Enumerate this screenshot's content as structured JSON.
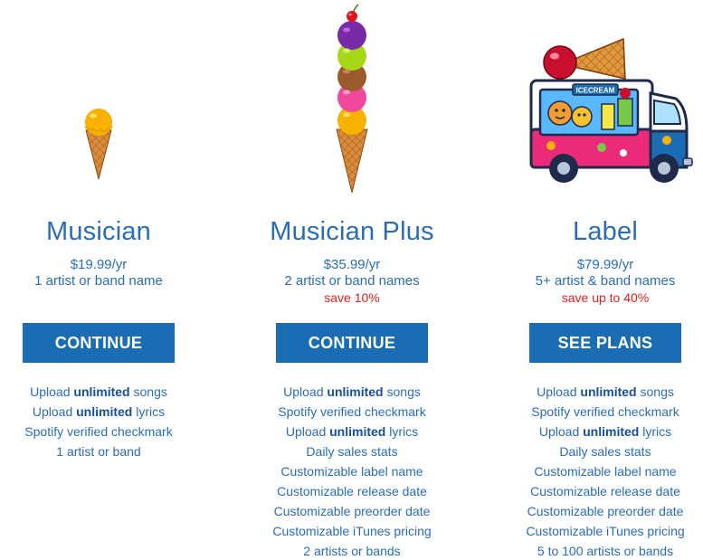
{
  "plans": [
    {
      "illustration": "single-scoop-cone",
      "name": "Musician",
      "price": "$19.99/yr",
      "description": "1 artist or band name",
      "save": "",
      "button": "CONTINUE",
      "features": [
        "Upload unlimited songs",
        "Upload unlimited lyrics",
        "Spotify verified checkmark",
        "1 artist or band"
      ]
    },
    {
      "illustration": "five-scoop-cone",
      "name": "Musician Plus",
      "price": "$35.99/yr",
      "description": "2 artist or band names",
      "save": "save 10%",
      "button": "CONTINUE",
      "features": [
        "Upload unlimited songs",
        "Spotify verified checkmark",
        "Upload unlimited lyrics",
        "Daily sales stats",
        "Customizable label name",
        "Customizable release date",
        "Customizable preorder date",
        "Customizable iTunes pricing",
        "2 artists or bands"
      ]
    },
    {
      "illustration": "ice-cream-truck",
      "name": "Label",
      "price": "$79.99/yr",
      "description": "5+ artist & band names",
      "save": "save up to 40%",
      "button": "SEE PLANS",
      "features": [
        "Upload unlimited songs",
        "Spotify verified checkmark",
        "Upload unlimited lyrics",
        "Daily sales stats",
        "Customizable label name",
        "Customizable release date",
        "Customizable preorder date",
        "Customizable iTunes pricing",
        "5 to 100 artists or bands"
      ]
    }
  ],
  "truck_sign": "ICECREAM",
  "emphasis_word": "unlimited",
  "colors": {
    "title": "#2a6db5",
    "button_bg": "#1a6db3",
    "button_text": "#ffffff",
    "save": "#e02020",
    "cone": "#d4883a"
  }
}
